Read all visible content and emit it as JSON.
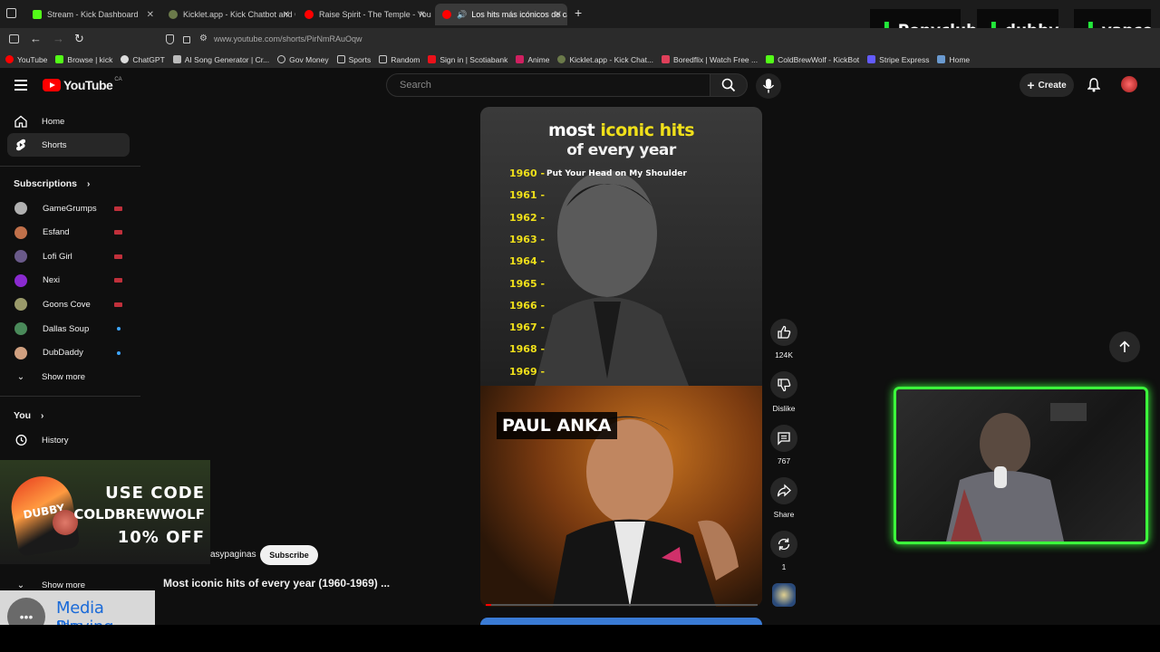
{
  "browser": {
    "tabs": [
      {
        "label": "Stream - Kick Dashboard",
        "color": "#53fc18",
        "active": false
      },
      {
        "label": "Kicklet.app - Kick Chatbot and C",
        "color": "#6b7a4a",
        "active": false
      },
      {
        "label": "Raise Spirit - The Temple - YouT",
        "color": "#ff0000",
        "active": false
      },
      {
        "label": "Los hits más icónicos de ca",
        "color": "#ff0000",
        "active": true
      }
    ],
    "url": "www.youtube.com/shorts/PirNmRAuOqw",
    "bookmarks": [
      "YouTube",
      "Browse | kick",
      "ChatGPT",
      "AI Song Generator | Cr...",
      "Gov Money",
      "Sports",
      "Random",
      "Sign in | Scotiabank",
      "Anime",
      "Kicklet.app - Kick Chat...",
      "Boredflix | Watch Free ...",
      "ColdBrewWolf - KickBot",
      "Stripe Express",
      "Home"
    ]
  },
  "stream_overlay": {
    "names": [
      "Ponyclub",
      "dubby",
      "vance"
    ]
  },
  "youtube": {
    "logo_text": "YouTube",
    "logo_region": "CA",
    "search_placeholder": "Search",
    "create_label": "Create",
    "sidebar": {
      "home": "Home",
      "shorts": "Shorts",
      "subscriptions_heading": "Subscriptions",
      "subscriptions": [
        {
          "name": "GameGrumps",
          "status": "live",
          "avatar": "#b0b0b0"
        },
        {
          "name": "Esfand",
          "status": "live",
          "avatar": "#c0704a"
        },
        {
          "name": "Lofi Girl",
          "status": "live",
          "avatar": "#6a5a8a"
        },
        {
          "name": "Nexi",
          "status": "live",
          "avatar": "#8a2ad0"
        },
        {
          "name": "Goons Cove",
          "status": "live",
          "avatar": "#9a9a6a"
        },
        {
          "name": "Dallas Soup",
          "status": "new",
          "avatar": "#4a8a5a"
        },
        {
          "name": "DubDaddy",
          "status": "new",
          "avatar": "#d0a080"
        }
      ],
      "show_more": "Show more",
      "you_heading": "You",
      "history": "History",
      "show_more_2": "Show more"
    },
    "short": {
      "title_line1_a": "most ",
      "title_line1_b": "iconic hits",
      "title_line2": "of every year",
      "years": [
        "1960 -",
        "1961 -",
        "1962 -",
        "1963 -",
        "1964 -",
        "1965 -",
        "1966 -",
        "1967 -",
        "1968 -",
        "1969 -"
      ],
      "song_1960": "Put Your Head on My Shoulder",
      "artist": "PAUL ANKA",
      "channel": "asypaginas",
      "subscribe": "Subscribe",
      "description": "Most iconic hits of every year (1960-1969) ...",
      "progress": 0.02
    },
    "actions": {
      "likes": "124K",
      "dislike": "Dislike",
      "comments": "767",
      "share": "Share",
      "remix": "1"
    }
  },
  "promo": {
    "line1": "USE CODE",
    "line2": "COLDBREWWOLF",
    "line3": "10% OFF",
    "brand": "DUBBY"
  },
  "media_widget": {
    "title": "Media Playing",
    "subtitle": "None"
  }
}
